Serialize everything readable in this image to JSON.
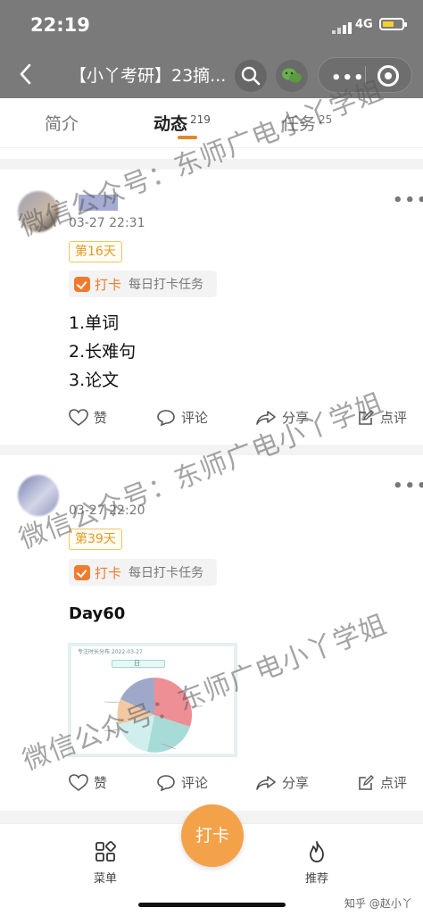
{
  "status_bar": {
    "time": "22:19",
    "network": "4G"
  },
  "nav": {
    "title": "【小丫考研】23摘..."
  },
  "tabs": [
    {
      "label": "简介",
      "count": ""
    },
    {
      "label": "动态",
      "count": "219"
    },
    {
      "label": "任务",
      "count": "25"
    }
  ],
  "posts": [
    {
      "time": "03-27 22:31",
      "badge": "第16天",
      "task_label": "打卡",
      "task_desc": "每日打卡任务",
      "content_lines": [
        "1.单词",
        "2.长难句",
        "3.论文"
      ],
      "actions": {
        "like": "赞",
        "comment": "评论",
        "share": "分享",
        "review": "点评"
      }
    },
    {
      "time": "03-27 22:20",
      "badge": "第39天",
      "task_label": "打卡",
      "task_desc": "每日打卡任务",
      "content_lines": [
        "Day60"
      ],
      "image": {
        "title": "专注时长分布 2022-03-27",
        "tab": "日"
      },
      "actions": {
        "like": "赞",
        "comment": "评论",
        "share": "分享",
        "review": "点评"
      }
    }
  ],
  "watermark": "微信公众号：东师广电小丫学姐",
  "bottom_bar": {
    "menu": "菜单",
    "checkin": "打卡",
    "recommend": "推荐"
  },
  "source": "知乎 @赵小丫",
  "colors": {
    "accent": "#f07b2e",
    "badge": "#e39b22",
    "fab": "#f3a24a",
    "header": "#7a7a7a"
  }
}
